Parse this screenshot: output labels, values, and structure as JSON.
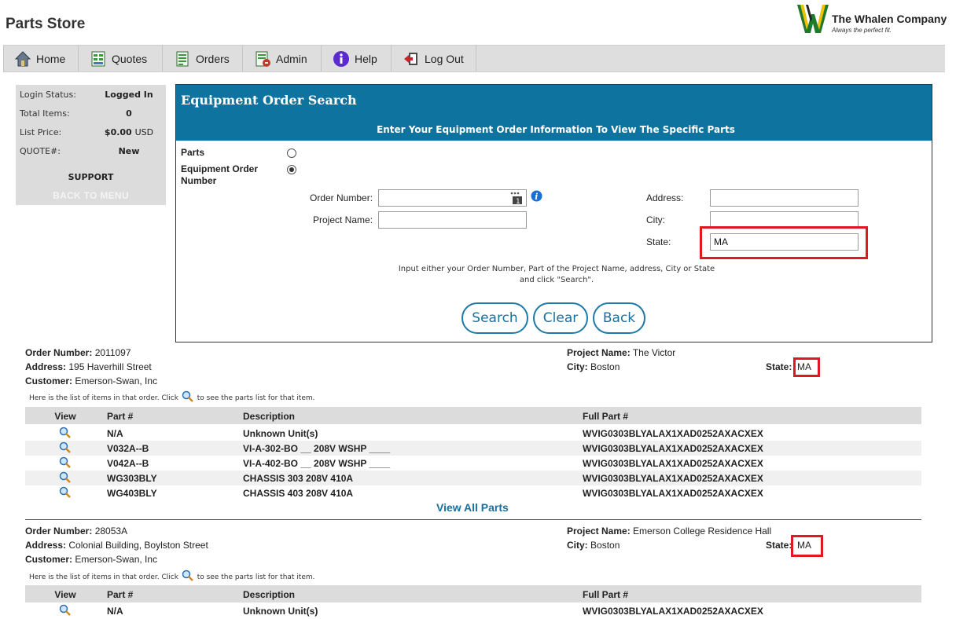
{
  "header": {
    "app_title": "Parts Store",
    "company_name": "The Whalen Company",
    "company_tagline": "Always the perfect fit.",
    "logo_letter": "W"
  },
  "nav": {
    "items": [
      {
        "label": "Home",
        "icon": "home-icon"
      },
      {
        "label": "Quotes",
        "icon": "quotes-icon"
      },
      {
        "label": "Orders",
        "icon": "orders-icon"
      },
      {
        "label": "Admin",
        "icon": "admin-icon"
      },
      {
        "label": "Help",
        "icon": "help-icon"
      },
      {
        "label": "Log Out",
        "icon": "logout-icon"
      }
    ]
  },
  "status": {
    "login_status_label": "Login Status:",
    "login_status_value": "Logged In",
    "total_items_label": "Total Items:",
    "total_items_value": "0",
    "list_price_label": "List Price:",
    "list_price_value": "$0.00",
    "list_price_unit": "USD",
    "quote_label": "QUOTE#:",
    "quote_value": "New",
    "support_label": "SUPPORT",
    "back_to_menu_label": "BACK TO MENU"
  },
  "search": {
    "title": "Equipment Order Search",
    "subtitle": "Enter Your Equipment Order Information To View The Specific Parts",
    "option_parts": "Parts",
    "option_equipment": "Equipment Order Number",
    "selected_option": "equipment",
    "order_number_label": "Order Number:",
    "order_number_value": "",
    "project_name_label": "Project Name:",
    "project_name_value": "",
    "address_label": "Address:",
    "address_value": "",
    "city_label": "City:",
    "city_value": "",
    "state_label": "State:",
    "state_value": "MA",
    "hint_line1": "Input either your Order Number, Part of the Project Name, address, City or State",
    "hint_line2": "and click \"Search\".",
    "search_button": "Search",
    "clear_button": "Clear",
    "back_button": "Back"
  },
  "results": {
    "order_number_label": "Order Number:",
    "address_label": "Address:",
    "customer_label": "Customer:",
    "project_name_label": "Project Name:",
    "city_label": "City:",
    "state_label": "State:",
    "note_before": "Here is the list of items in that order. Click",
    "note_after": "to see the parts list for that item.",
    "columns": [
      "View",
      "Part #",
      "Description",
      "Full Part #"
    ],
    "view_all_label": "View All Parts",
    "orders": [
      {
        "order_number": "2011097",
        "address": "195 Haverhill Street",
        "customer": "Emerson-Swan, Inc",
        "project_name": "The Victor",
        "city": "Boston",
        "state": "MA",
        "rows": [
          {
            "part": "N/A",
            "description": "Unknown Unit(s)",
            "full_part": "WVIG0303BLYALAX1XAD0252AXACXEX"
          },
          {
            "part": "V032A--B",
            "description": "VI-A-302-BO __ 208V WSHP ____",
            "full_part": "WVIG0303BLYALAX1XAD0252AXACXEX"
          },
          {
            "part": "V042A--B",
            "description": "VI-A-402-BO __ 208V WSHP ____",
            "full_part": "WVIG0303BLYALAX1XAD0252AXACXEX"
          },
          {
            "part": "WG303BLY",
            "description": "CHASSIS 303 208V 410A",
            "full_part": "WVIG0303BLYALAX1XAD0252AXACXEX"
          },
          {
            "part": "WG403BLY",
            "description": "CHASSIS 403 208V 410A",
            "full_part": "WVIG0303BLYALAX1XAD0252AXACXEX"
          }
        ]
      },
      {
        "order_number": "28053A",
        "address": "Colonial Building, Boylston Street",
        "customer": "Emerson-Swan, Inc",
        "project_name": "Emerson College Residence Hall",
        "city": "Boston",
        "state": "MA",
        "rows": [
          {
            "part": "N/A",
            "description": "Unknown Unit(s)",
            "full_part": "WVIG0303BLYALAX1XAD0252AXACXEX"
          }
        ]
      }
    ]
  },
  "colors": {
    "header_blue": "#0f73a0",
    "highlight_red": "#dd1a22",
    "link_blue": "#1b6f9e"
  }
}
